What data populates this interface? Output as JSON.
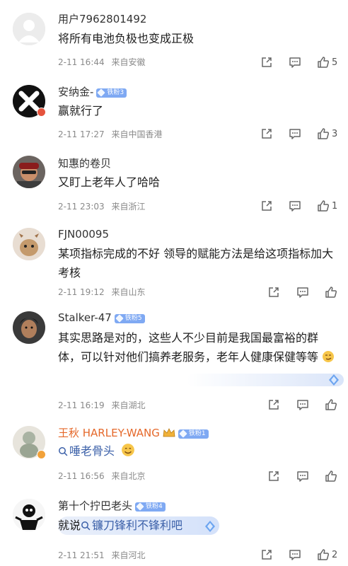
{
  "comments": [
    {
      "user": "用户7962801492",
      "text": "将所有电池负极也变成正极",
      "date": "2-11 16:44",
      "location": "来自安徽",
      "likes": "5"
    },
    {
      "user": "安纳金-",
      "badge": "铁粉3",
      "text": "赢就行了",
      "date": "2-11 17:27",
      "location": "来自中国香港",
      "likes": "3"
    },
    {
      "user": "知惠的卷贝",
      "text": "又盯上老年人了哈哈",
      "date": "2-11 23:03",
      "location": "来自浙江",
      "likes": "1"
    },
    {
      "user": "FJN00095",
      "text": "某项指标完成的不好 领导的赋能方法是给这项指标加大考核",
      "date": "2-11 19:12",
      "location": "来自山东",
      "likes": ""
    },
    {
      "user": "Stalker-47",
      "badge": "铁粉5",
      "text": "其实思路是对的，这些人不少目前是我国最富裕的群体，可以针对他们搞养老服务，老年人健康保健等等",
      "date": "2-11 16:19",
      "location": "来自湖北",
      "likes": ""
    },
    {
      "user": "王秋 HARLEY-WANG",
      "badge": "铁粉1",
      "topic": "唾老骨头",
      "date": "2-11 16:56",
      "location": "来自北京",
      "likes": ""
    },
    {
      "user": "第十个拧巴老头",
      "badge": "铁粉4",
      "text_prefix": "就说",
      "topic": "镰刀锋利不锋利吧",
      "date": "2-11 21:51",
      "location": "来自河北",
      "likes": "2"
    }
  ]
}
